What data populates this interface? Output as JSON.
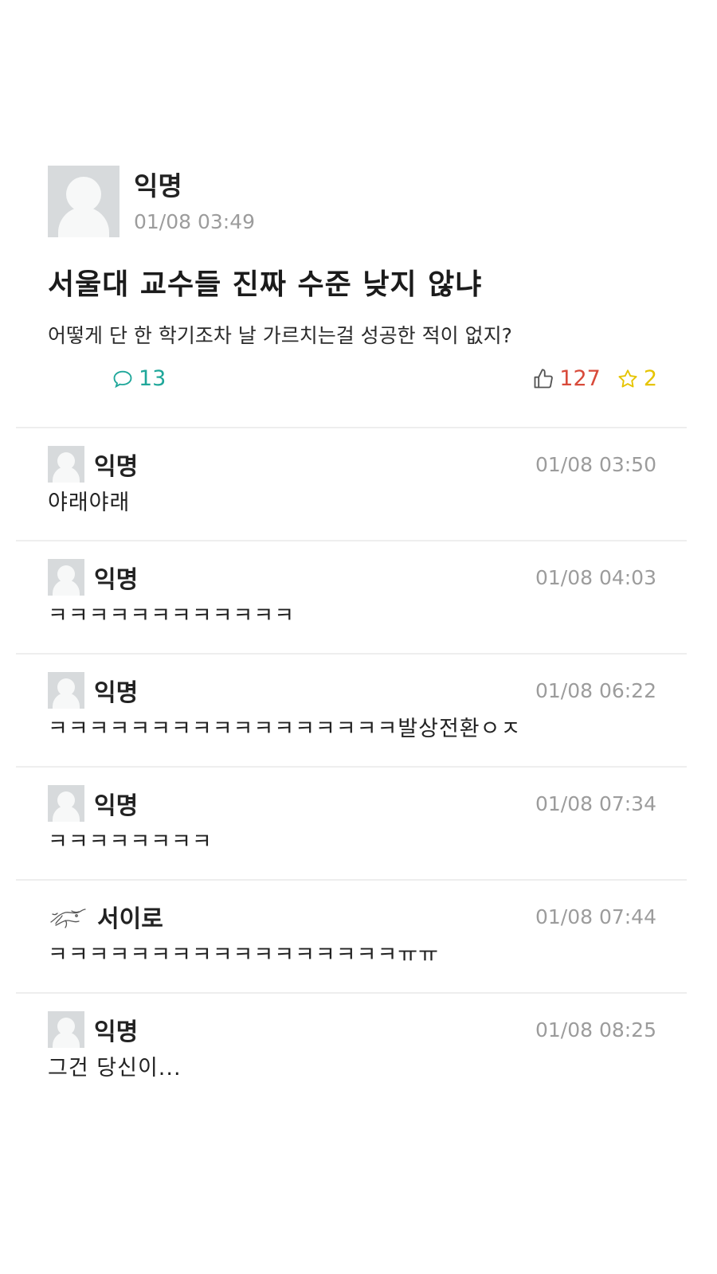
{
  "post": {
    "author": "익명",
    "time": "01/08 03:49",
    "title": "서울대 교수들 진짜 수준 낮지 않냐",
    "body": "어떻게 단 한 학기조차 날 가르치는걸 성공한 적이 없지?",
    "likes": "127",
    "comments": "13",
    "scraps": "2"
  },
  "colors": {
    "like": "#d84a3a",
    "comment": "#1fa79a",
    "scrap": "#e6c400"
  },
  "comments": [
    {
      "author": "익명",
      "time": "01/08 03:50",
      "text": "야래야래",
      "avatar": "default-avatar"
    },
    {
      "author": "익명",
      "time": "01/08 04:03",
      "text": "ㅋㅋㅋㅋㅋㅋㅋㅋㅋㅋㅋㅋ",
      "avatar": "default-avatar"
    },
    {
      "author": "익명",
      "time": "01/08 06:22",
      "text": "ㅋㅋㅋㅋㅋㅋㅋㅋㅋㅋㅋㅋㅋㅋㅋㅋㅋ발상전환ㅇㅈ",
      "avatar": "default-avatar"
    },
    {
      "author": "익명",
      "time": "01/08 07:34",
      "text": "ㅋㅋㅋㅋㅋㅋㅋㅋ",
      "avatar": "default-avatar"
    },
    {
      "author": "서이로",
      "time": "01/08 07:44",
      "text": "ㅋㅋㅋㅋㅋㅋㅋㅋㅋㅋㅋㅋㅋㅋㅋㅋㅋㅠㅠ",
      "avatar": "sketch-avatar"
    },
    {
      "author": "익명",
      "time": "01/08 08:25",
      "text": "그건 당신이...",
      "avatar": "default-avatar"
    }
  ]
}
